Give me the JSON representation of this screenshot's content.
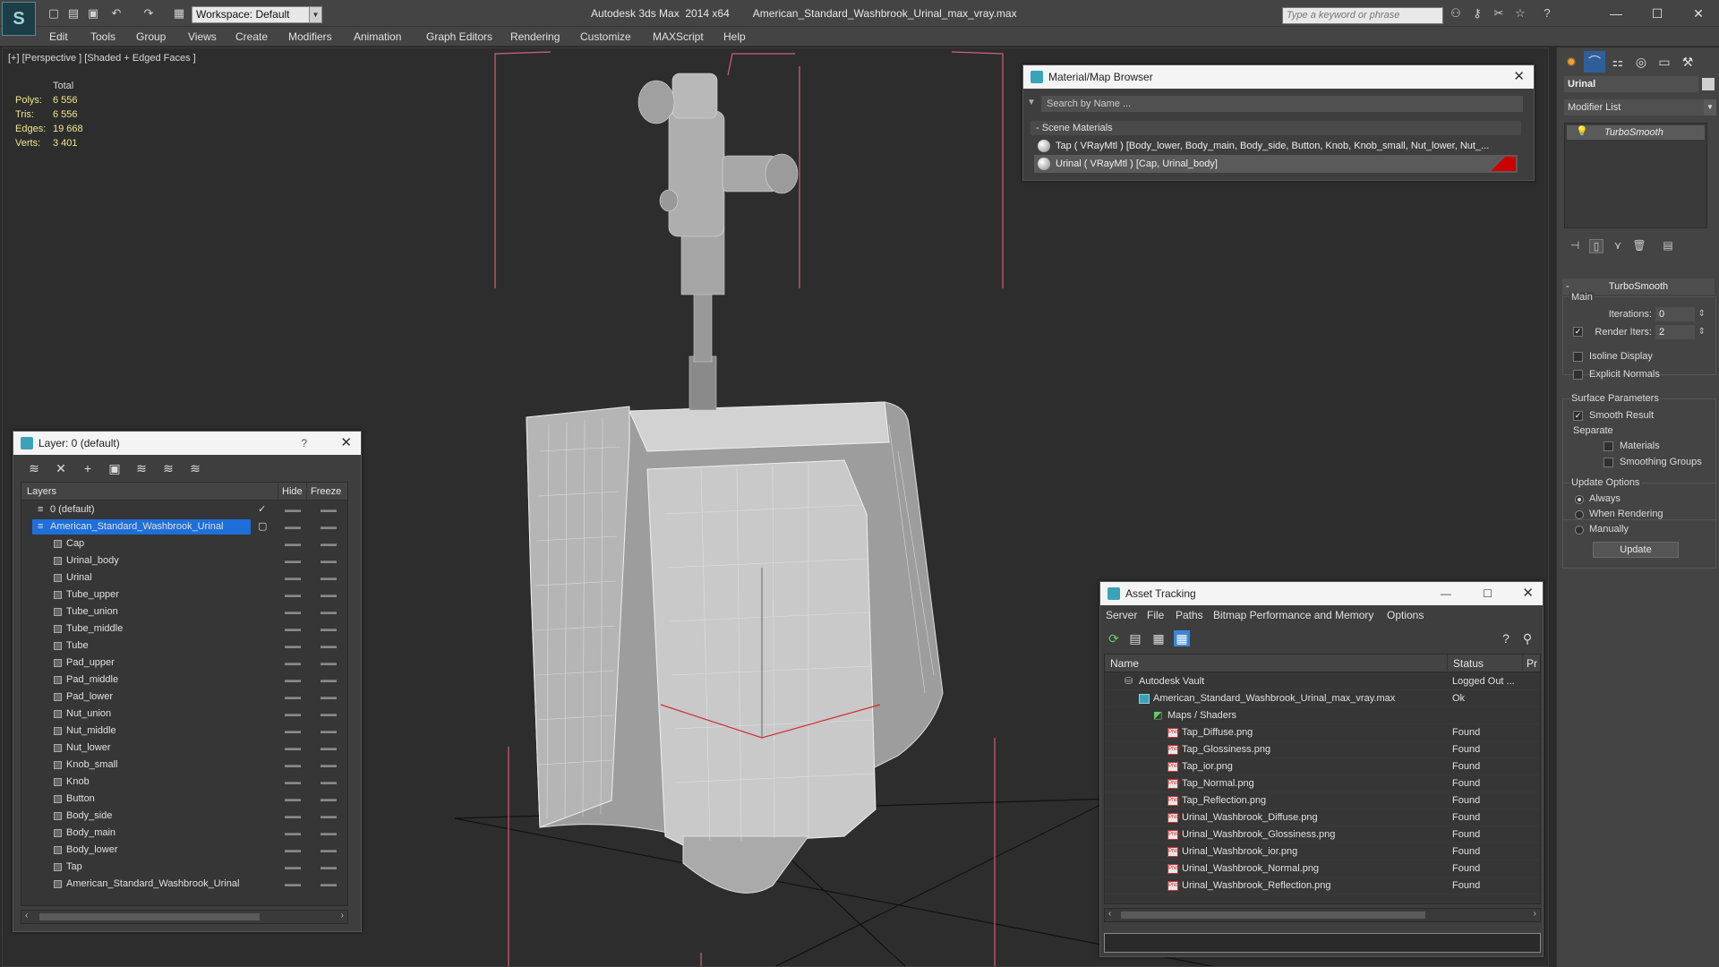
{
  "titlebar": {
    "workspace": "Workspace: Default",
    "app_name": "Autodesk 3ds Max  2014 x64",
    "file_name": "American_Standard_Washbrook_Urinal_max_vray.max",
    "search_placeholder": "Type a keyword or phrase"
  },
  "menu": [
    "Edit",
    "Tools",
    "Group",
    "Views",
    "Create",
    "Modifiers",
    "Animation",
    "Graph Editors",
    "Rendering",
    "Customize",
    "MAXScript",
    "Help"
  ],
  "viewport": {
    "label": "[+] [Perspective ] [Shaded + Edged Faces ]",
    "stats": {
      "header": "Total",
      "polys_label": "Polys:",
      "polys": "6 556",
      "tris_label": "Tris:",
      "tris": "6 556",
      "edges_label": "Edges:",
      "edges": "19 668",
      "verts_label": "Verts:",
      "verts": "3 401"
    }
  },
  "material_browser": {
    "title": "Material/Map Browser",
    "search_placeholder": "Search by Name ...",
    "group": "- Scene Materials",
    "materials": [
      "Tap  ( VRayMtl ) [Body_lower, Body_main, Body_side, Button, Knob, Knob_small, Nut_lower, Nut_...",
      "Urinal  ( VRayMtl ) [Cap, Urinal_body]"
    ]
  },
  "layer_window": {
    "title": "Layer: 0 (default)",
    "help": "?",
    "columns": {
      "layers": "Layers",
      "hide": "Hide",
      "freeze": "Freeze"
    },
    "default_layer": "0 (default)",
    "selected_layer": "American_Standard_Washbrook_Urinal",
    "objects": [
      "Cap",
      "Urinal_body",
      "Urinal",
      "Tube_upper",
      "Tube_union",
      "Tube_middle",
      "Tube",
      "Pad_upper",
      "Pad_middle",
      "Pad_lower",
      "Nut_union",
      "Nut_middle",
      "Nut_lower",
      "Knob_small",
      "Knob",
      "Button",
      "Body_side",
      "Body_main",
      "Body_lower",
      "Tap",
      "American_Standard_Washbrook_Urinal"
    ]
  },
  "asset_tracking": {
    "title": "Asset Tracking",
    "menu": [
      "Server",
      "File",
      "Paths",
      "Bitmap Performance and Memory",
      "Options"
    ],
    "columns": {
      "name": "Name",
      "status": "Status",
      "path": "Pr"
    },
    "rows": [
      {
        "name": "Autodesk Vault",
        "status": "Logged Out ...",
        "indent": 1,
        "icon": "vault"
      },
      {
        "name": "American_Standard_Washbrook_Urinal_max_vray.max",
        "status": "Ok",
        "indent": 2,
        "icon": "max"
      },
      {
        "name": "Maps / Shaders",
        "status": "",
        "indent": 3,
        "icon": "maps"
      },
      {
        "name": "Tap_Diffuse.png",
        "status": "Found",
        "indent": 4,
        "icon": "png"
      },
      {
        "name": "Tap_Glossiness.png",
        "status": "Found",
        "indent": 4,
        "icon": "png"
      },
      {
        "name": "Tap_ior.png",
        "status": "Found",
        "indent": 4,
        "icon": "png"
      },
      {
        "name": "Tap_Normal.png",
        "status": "Found",
        "indent": 4,
        "icon": "png"
      },
      {
        "name": "Tap_Reflection.png",
        "status": "Found",
        "indent": 4,
        "icon": "png"
      },
      {
        "name": "Urinal_Washbrook_Diffuse.png",
        "status": "Found",
        "indent": 4,
        "icon": "png"
      },
      {
        "name": "Urinal_Washbrook_Glossiness.png",
        "status": "Found",
        "indent": 4,
        "icon": "png"
      },
      {
        "name": "Urinal_Washbrook_ior.png",
        "status": "Found",
        "indent": 4,
        "icon": "png"
      },
      {
        "name": "Urinal_Washbrook_Normal.png",
        "status": "Found",
        "indent": 4,
        "icon": "png"
      },
      {
        "name": "Urinal_Washbrook_Reflection.png",
        "status": "Found",
        "indent": 4,
        "icon": "png"
      }
    ]
  },
  "command_panel": {
    "object_name": "Urinal",
    "modifier_list": "Modifier List",
    "stack_item": "TurboSmooth",
    "rollout_title": "TurboSmooth",
    "main_group": "Main",
    "iterations_label": "Iterations:",
    "iterations": "0",
    "render_iters_label": "Render Iters:",
    "render_iters": "2",
    "isoline_display": "Isoline Display",
    "explicit_normals": "Explicit Normals",
    "surface_params": "Surface Parameters",
    "smooth_result": "Smooth Result",
    "separate": "Separate",
    "materials": "Materials",
    "smoothing_groups": "Smoothing Groups",
    "update_options": "Update Options",
    "always": "Always",
    "when_rendering": "When Rendering",
    "manually": "Manually",
    "update_button": "Update"
  },
  "colors": {
    "accent": "#3399ff",
    "selection": "#1e6fd9",
    "viewport_bg": "#2d2d2d",
    "bbox": "#d0607a"
  }
}
